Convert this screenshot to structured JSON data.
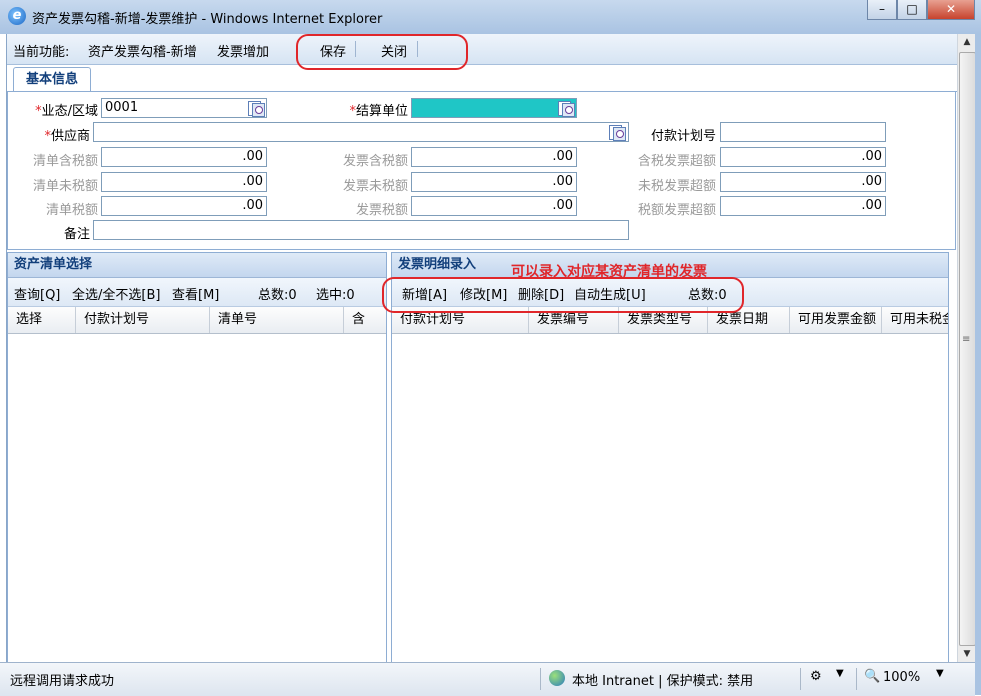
{
  "window": {
    "title": "资产发票勾稽-新增-发票维护 - Windows Internet Explorer",
    "controls": [
      "minimize-icon",
      "maximize-icon",
      "close-icon"
    ]
  },
  "funcbar": {
    "current_label": "当前功能:",
    "crumb1": "资产发票勾稽-新增",
    "crumb2": "发票增加",
    "save": "保存",
    "close": "关闭"
  },
  "tab": {
    "label": "基本信息"
  },
  "form": {
    "business_region": {
      "label": "业态/区域",
      "value": "0001",
      "required": true
    },
    "settle_unit": {
      "label": "结算单位",
      "value": "",
      "required": true
    },
    "supplier": {
      "label": "供应商",
      "value": "",
      "required": true
    },
    "pay_plan_no": {
      "label": "付款计划号",
      "value": ""
    },
    "list_tax_incl": {
      "label": "清单含税额",
      "value": ".00"
    },
    "invoice_tax_incl": {
      "label": "发票含税额",
      "value": ".00"
    },
    "tax_incl_over": {
      "label": "含税发票超额",
      "value": ".00"
    },
    "list_tax_excl": {
      "label": "清单未税额",
      "value": ".00"
    },
    "invoice_tax_excl": {
      "label": "发票未税额",
      "value": ".00"
    },
    "tax_excl_over": {
      "label": "未税发票超额",
      "value": ".00"
    },
    "list_tax": {
      "label": "清单税额",
      "value": ".00"
    },
    "invoice_tax": {
      "label": "发票税额",
      "value": ".00"
    },
    "tax_over": {
      "label": "税额发票超额",
      "value": ".00"
    },
    "remark": {
      "label": "备注",
      "value": ""
    }
  },
  "left_panel": {
    "title": "资产清单选择",
    "toolbar": {
      "query": "查询[Q]",
      "select_all": "全选/全不选[B]",
      "view": "查看[M]",
      "total": "总数:0",
      "selected": "选中:0"
    },
    "columns": [
      "选择",
      "付款计划号",
      "清单号",
      "含"
    ]
  },
  "right_panel": {
    "title": "发票明细录入",
    "annotation": "可以录入对应某资产清单的发票",
    "toolbar": {
      "add": "新增[A]",
      "edit": "修改[M]",
      "delete": "删除[D]",
      "auto": "自动生成[U]",
      "total": "总数:0"
    },
    "columns": [
      "付款计划号",
      "发票编号",
      "发票类型号",
      "发票日期",
      "可用发票金额",
      "可用未税金"
    ]
  },
  "status": {
    "message": "远程调用请求成功",
    "zone": "本地 Intranet | 保护模式: 禁用",
    "zoom": "100%"
  },
  "colors": {
    "required": "#e0262a",
    "annotation": "#e0262a",
    "highlight_field": "#1fc6c6",
    "header_text": "#123f7b"
  }
}
